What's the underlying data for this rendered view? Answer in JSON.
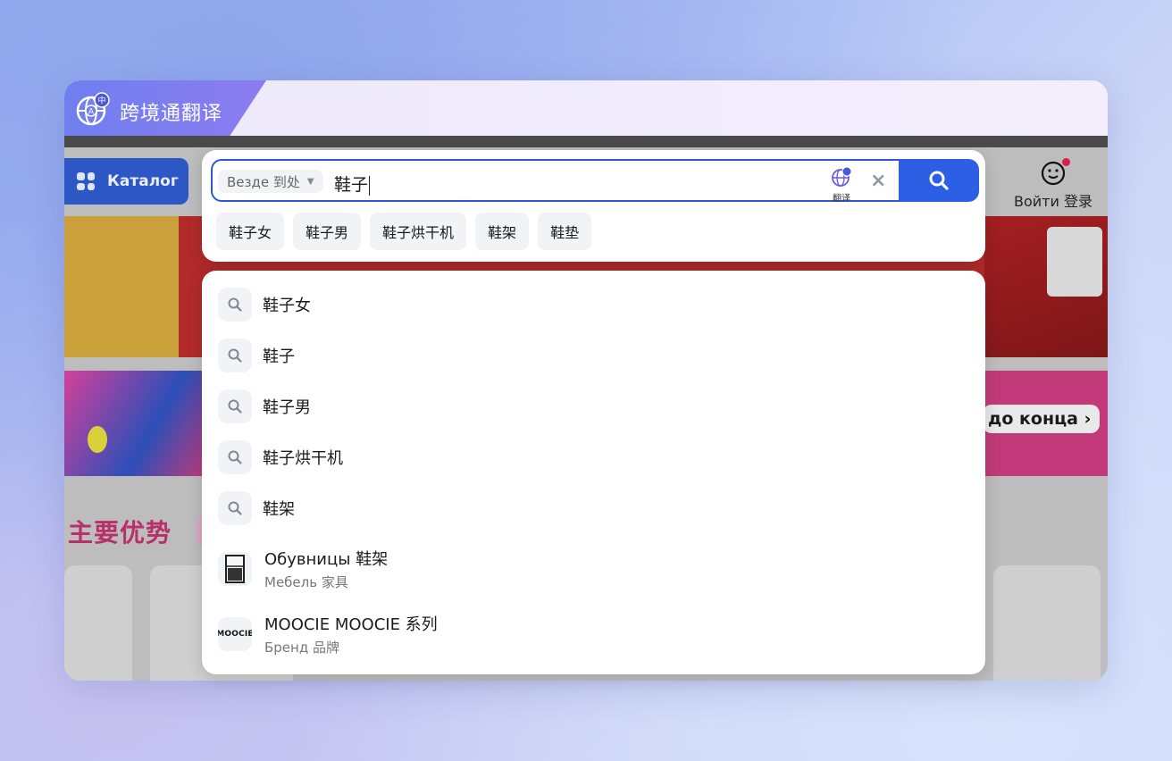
{
  "plugin": {
    "title": "跨境通翻译"
  },
  "site": {
    "catalog_label": "Каталог",
    "login_label": "Войти 登录",
    "banner_cta": "до конца",
    "section_title": "主要优势"
  },
  "search": {
    "scope_label": "Везде 到处",
    "query": "鞋子",
    "translate_label": "翻译",
    "chips": [
      "鞋子女",
      "鞋子男",
      "鞋子烘干机",
      "鞋架",
      "鞋垫"
    ]
  },
  "suggestions": [
    {
      "text": "鞋子女"
    },
    {
      "text": "鞋子"
    },
    {
      "text": "鞋子男"
    },
    {
      "text": "鞋子烘干机"
    },
    {
      "text": "鞋架"
    }
  ],
  "rich_suggestions": [
    {
      "title": "Обувницы 鞋架",
      "subtitle": "Мебель 家具"
    },
    {
      "title": "MOOCIE MOOCIE 系列",
      "subtitle": "Бренд 品牌",
      "logo_text": "MOOCIE"
    }
  ],
  "colors": {
    "accent": "#2c5fe3",
    "plugin_accent": "#7b7ff0",
    "section_title": "#b8306a"
  }
}
